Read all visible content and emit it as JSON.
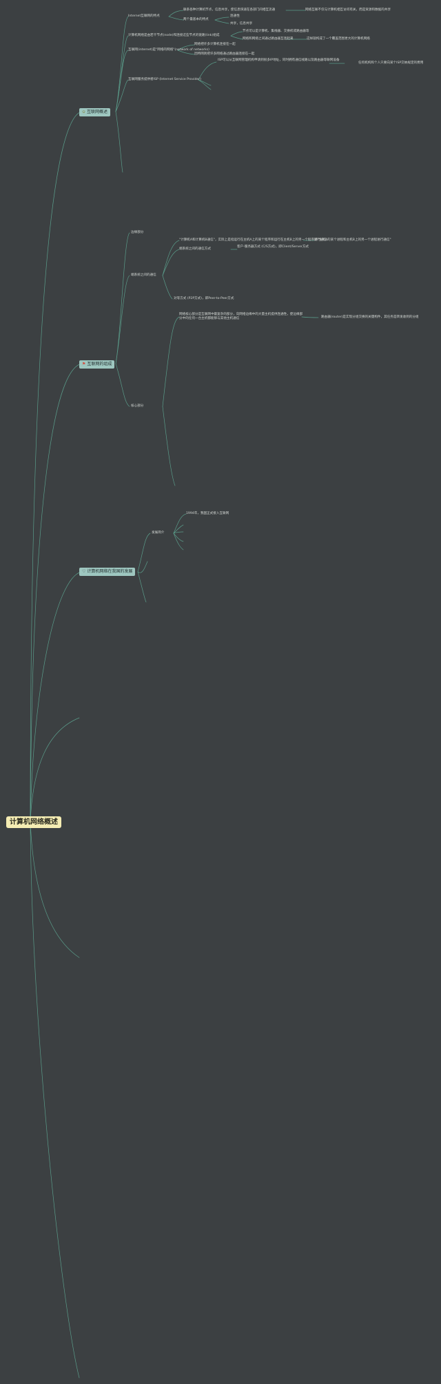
{
  "root": {
    "label": "计算机网络概述"
  },
  "topics": [
    {
      "label": "互联网概述",
      "icon": "star-icon",
      "glyph": "✩",
      "icon_color": "#e9d36b"
    },
    {
      "label": "互联网的组成",
      "icon": "flag-icon",
      "glyph": "⚑",
      "icon_color": "#d44a3a"
    },
    {
      "label": "计算机网络在我国的发展",
      "icon": "heart-icon",
      "glyph": "♡",
      "icon_color": "#333333"
    }
  ],
  "nodes": {
    "n1": "Internet互联网的特点",
    "n1a": "联系各种计算机节点，信息共享，使信息快速在各部门间相互流通",
    "n1a1": "网络互联不仅与计算机相互访问有关，而是资源和数据的共享",
    "n1b": "两个最基本的特点",
    "n1b1": "连通性",
    "n1b2": "共享，信息共享",
    "n2": "计算机网络是由若干节点(node)和连接这些节点的链路(link)组成",
    "n2a": "节点可以是计算机、集线器、交换机或路由器等",
    "n2b": "网络和网络之间通过路由器互连起来",
    "n2b1": "这样就构成了一个覆盖范围更大的计算机网络",
    "n3": "互联网(internet)是\"网络的网络\"(network of networks)",
    "n3a": "网络把许多计算机连接在一起",
    "n3b": "因特网则把许多网络通过路由器连接在一起",
    "n4": "互联网服务提供者ISP (Internet Service Provider)",
    "n4a": "ISP可以从互联网管理机构申请到很多IP地址，同时拥有通信线路以及路由器等联网设备",
    "n4a1": "任何机构和个人只要向某个ISP交纳规定的费用",
    "m1": "边缘部分",
    "m2": "端系统之间的通信",
    "m2a": "\"计算机A和计算机B通信\"，实际上是指运行在主机A上的某个程序和运行在主机B上的另一个程序进行通信",
    "m2a1": "即\"主机A的某个进程和主机B上的另一个进程进行通信\"",
    "m2b": "端系统之间的通信方式",
    "m2b1": "客户-服务器方式 (C/S方式)，即Client/Server方式",
    "m2b2": "对等方式 (P2P方式)，即Peer-to-Peer方式",
    "m3": "核心部分",
    "m3a": "网络核心部分是互联网中最复杂的部分，向网络边缘中的大量主机提供连通性，使边缘部分中的任何一台主机都能够与其他主机通信",
    "m3a1": "路由器(router)是实现分组交换的关键构件，其任务是转发收到的分组",
    "c1": "发展简介",
    "c1a": "1994年，我国正式接入互联网"
  }
}
